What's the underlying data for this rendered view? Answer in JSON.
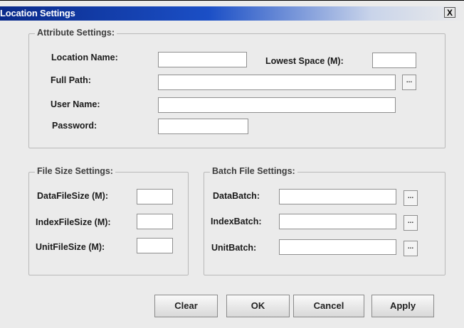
{
  "window": {
    "title": "Location Settings",
    "close_label": "X"
  },
  "attribute": {
    "title": "Attribute Settings:",
    "location_name": {
      "label": "Location Name:",
      "value": ""
    },
    "lowest_space": {
      "label": "Lowest Space (M):",
      "value": ""
    },
    "full_path": {
      "label": "Full Path:",
      "value": "",
      "browse": "..."
    },
    "user_name": {
      "label": "User Name:",
      "value": ""
    },
    "password": {
      "label": "Password:",
      "value": ""
    }
  },
  "file_size": {
    "title": "File Size Settings:",
    "data": {
      "label": "DataFileSize (M):",
      "value": ""
    },
    "index": {
      "label": "IndexFileSize (M):",
      "value": ""
    },
    "unit": {
      "label": "UnitFileSize (M):",
      "value": ""
    }
  },
  "batch": {
    "title": "Batch File Settings:",
    "data": {
      "label": "DataBatch:",
      "value": "",
      "browse": "..."
    },
    "index": {
      "label": "IndexBatch:",
      "value": "",
      "browse": "..."
    },
    "unit": {
      "label": "UnitBatch:",
      "value": "",
      "browse": "..."
    }
  },
  "buttons": {
    "clear": "Clear",
    "ok": "OK",
    "cancel": "Cancel",
    "apply": "Apply"
  }
}
